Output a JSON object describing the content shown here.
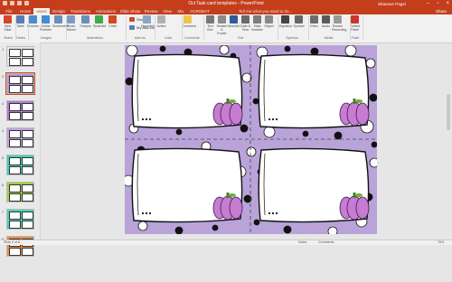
{
  "window": {
    "title": "Oct Task card templates - PowerPoint",
    "user": "Shannon Pagel",
    "controls": [
      "–",
      "▫",
      "×"
    ]
  },
  "tabs": [
    {
      "label": "File"
    },
    {
      "label": "Home"
    },
    {
      "label": "Insert"
    },
    {
      "label": "Design"
    },
    {
      "label": "Transitions"
    },
    {
      "label": "Animations"
    },
    {
      "label": "Slide Show"
    },
    {
      "label": "Review"
    },
    {
      "label": "View"
    },
    {
      "label": "Mix"
    },
    {
      "label": "ACROBAT"
    }
  ],
  "tellme": "Tell me what you want to do...",
  "share": "Share",
  "ribbon": {
    "buttons": [
      {
        "label": "New Slide",
        "icon": "new-slide-icon",
        "color": "#d24726"
      },
      {
        "label": "Table",
        "icon": "table-icon",
        "color": "#5b7bb1"
      },
      {
        "label": "Pictures",
        "icon": "pictures-icon",
        "color": "#4d8ccc"
      },
      {
        "label": "Online Pictures",
        "icon": "online-pictures-icon",
        "color": "#3f8fd2"
      },
      {
        "label": "Screenshot",
        "icon": "screenshot-icon",
        "color": "#6a8fbf"
      },
      {
        "label": "Photo Album",
        "icon": "photo-album-icon",
        "color": "#7a9cc4"
      },
      {
        "label": "Shapes",
        "icon": "shapes-icon",
        "color": "#6c8ebd"
      },
      {
        "label": "SmartArt",
        "icon": "smartart-icon",
        "color": "#3ea84a"
      },
      {
        "label": "Chart",
        "icon": "chart-icon",
        "color": "#d24726"
      },
      {
        "label": "Hyperlink",
        "icon": "hyperlink-icon",
        "color": "#8aa4c8"
      },
      {
        "label": "Action",
        "icon": "action-icon",
        "color": "#b0b0b0"
      },
      {
        "label": "Comment",
        "icon": "comment-icon",
        "color": "#f0c34a"
      },
      {
        "label": "Text Box",
        "icon": "text-box-icon",
        "color": "#777777"
      },
      {
        "label": "Header & Footer",
        "icon": "header-footer-icon",
        "color": "#8b8b8b"
      },
      {
        "label": "WordArt",
        "icon": "wordart-icon",
        "color": "#2e5c9a"
      },
      {
        "label": "Date & Time",
        "icon": "date-time-icon",
        "color": "#6a6a6a"
      },
      {
        "label": "Slide Number",
        "icon": "slide-number-icon",
        "color": "#7d7d7d"
      },
      {
        "label": "Object",
        "icon": "object-icon",
        "color": "#888888"
      },
      {
        "label": "Equation",
        "icon": "equation-icon",
        "color": "#444444"
      },
      {
        "label": "Symbol",
        "icon": "symbol-icon",
        "color": "#666666"
      },
      {
        "label": "Video",
        "icon": "video-icon",
        "color": "#6d6d6d"
      },
      {
        "label": "Audio",
        "icon": "audio-icon",
        "color": "#5a5a5a"
      },
      {
        "label": "Screen Recording",
        "icon": "screen-recording-icon",
        "color": "#999999"
      },
      {
        "label": "Embed Flash",
        "icon": "embed-flash-icon",
        "color": "#c8362c"
      }
    ],
    "small": [
      {
        "label": "Store",
        "icon": "store-icon",
        "color": "#d24726"
      },
      {
        "label": "My Add-ins",
        "icon": "add-ins-icon",
        "color": "#5b7bb1"
      }
    ],
    "groups": [
      {
        "label": "Slides"
      },
      {
        "label": "Tables"
      },
      {
        "label": "Images"
      },
      {
        "label": "Illustrations"
      },
      {
        "label": "Add-ins"
      },
      {
        "label": "Links"
      },
      {
        "label": "Comments"
      },
      {
        "label": "Text"
      },
      {
        "label": "Symbols"
      },
      {
        "label": "Media"
      },
      {
        "label": "Flash"
      }
    ]
  },
  "thumbnails": [
    {
      "num": "1",
      "color": "#e8e8e8",
      "selected": false
    },
    {
      "num": "2",
      "color": "#b49ad6",
      "selected": true
    },
    {
      "num": "3",
      "color": "#b07bd6",
      "selected": false
    },
    {
      "num": "4",
      "color": "#c1a0e0",
      "selected": false
    },
    {
      "num": "5",
      "color": "#3fd1b4",
      "selected": false
    },
    {
      "num": "6",
      "color": "#9ed04a",
      "selected": false
    },
    {
      "num": "7",
      "color": "#4fd1b6",
      "selected": false
    },
    {
      "num": "8",
      "color": "#ef8a3c",
      "selected": false
    }
  ],
  "slide": {
    "background": "#b9a3d9",
    "card_count": 4
  },
  "statusbar": {
    "left": "Slide 2 of 8",
    "notes": "Notes",
    "comments": "Comments",
    "zoom": "76%"
  },
  "colors": {
    "accent": "#c43e1c",
    "pumpkin": "#c77bd1"
  }
}
